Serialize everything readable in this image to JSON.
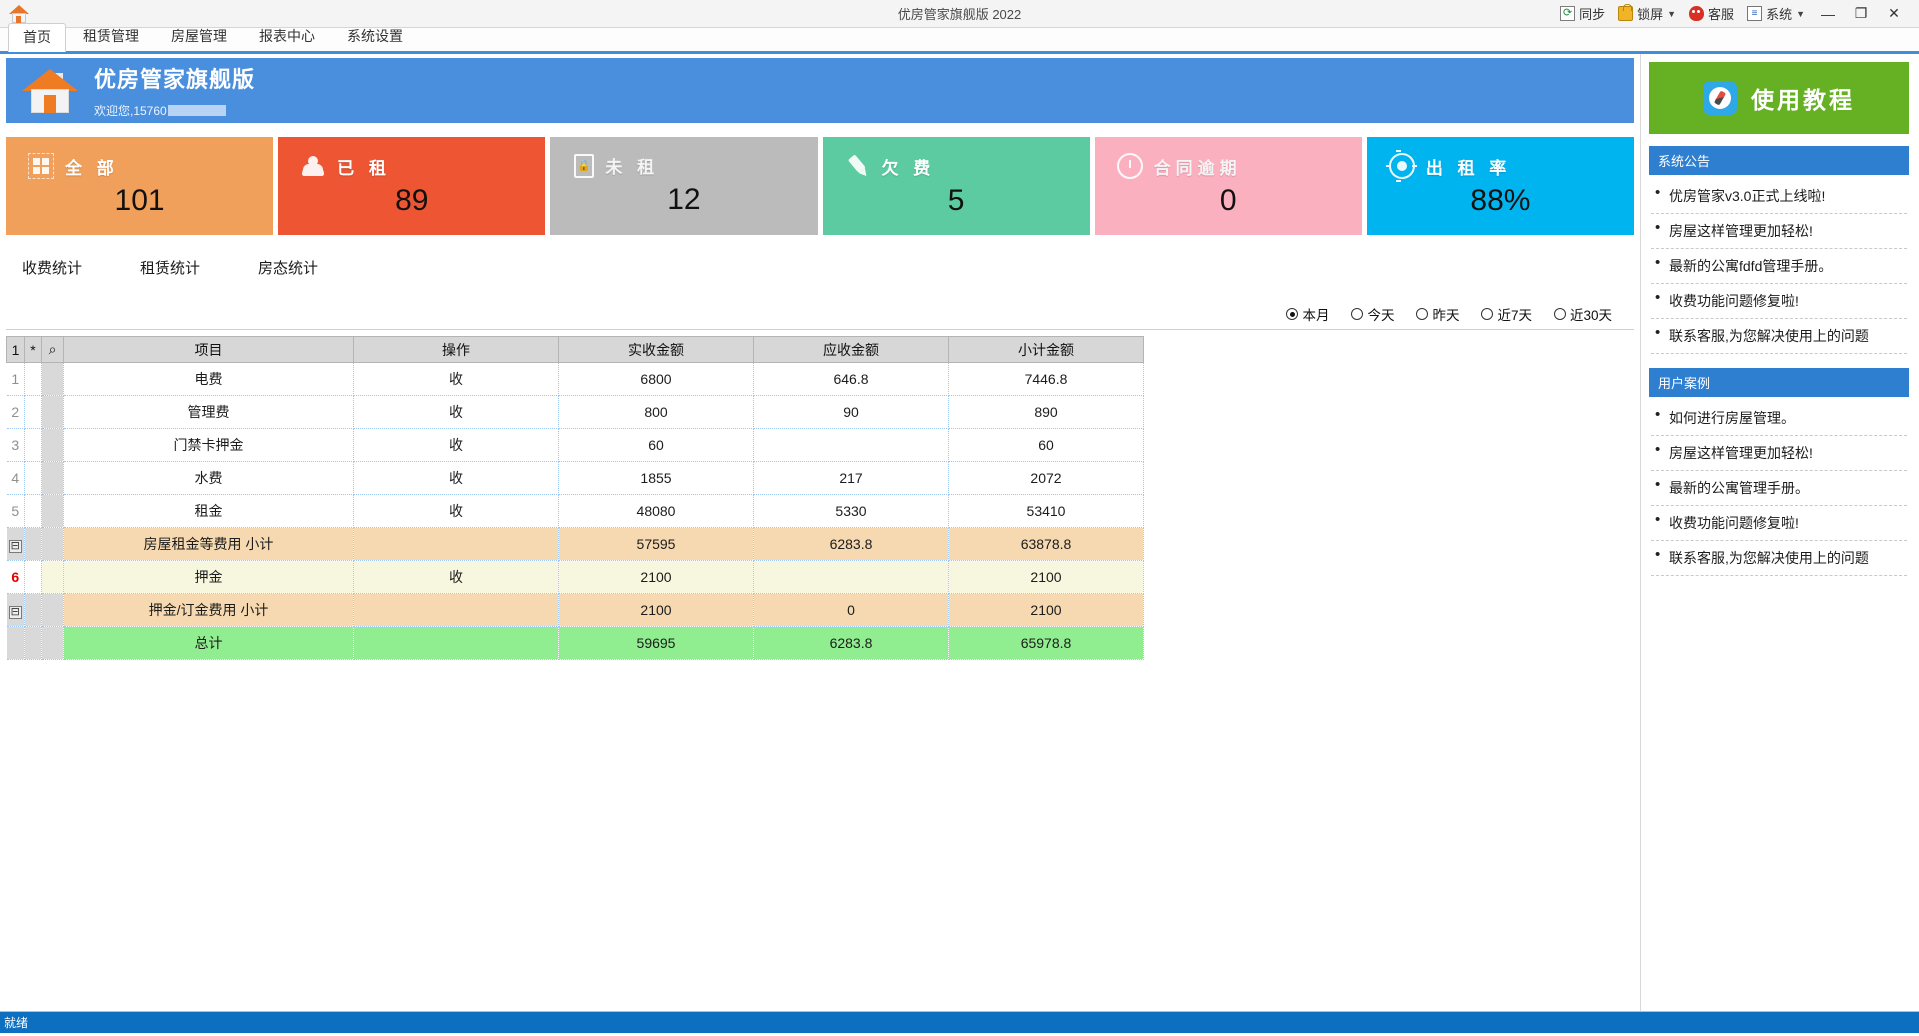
{
  "titlebar": {
    "title": "优房管家旗舰版 2022",
    "buttons": [
      {
        "label": "同步",
        "icon": "sync-icon",
        "caret": false
      },
      {
        "label": "锁屏",
        "icon": "lock-icon",
        "caret": true
      },
      {
        "label": "客服",
        "icon": "qq-icon",
        "caret": false
      },
      {
        "label": "系统",
        "icon": "system-icon",
        "caret": true
      }
    ],
    "minimize": "—",
    "maximize": "❐",
    "close": "✕"
  },
  "menu": {
    "tabs": [
      {
        "label": "首页",
        "active": true
      },
      {
        "label": "租赁管理",
        "active": false
      },
      {
        "label": "房屋管理",
        "active": false
      },
      {
        "label": "报表中心",
        "active": false
      },
      {
        "label": "系统设置",
        "active": false
      }
    ]
  },
  "banner": {
    "title": "优房管家旗舰版",
    "welcome_prefix": "欢迎您,15760"
  },
  "cards": [
    {
      "label": "全 部",
      "value": "101",
      "color": "#f0a05a",
      "icon": "grid-icon"
    },
    {
      "label": "已 租",
      "value": "89",
      "color": "#ee5533",
      "icon": "users-icon"
    },
    {
      "label": "未 租",
      "value": "12",
      "color": "#bbbbbb",
      "icon": "lock-door-icon"
    },
    {
      "label": "欠 费",
      "value": "5",
      "color": "#5ccba2",
      "icon": "pen-icon"
    },
    {
      "label": "合同逾期",
      "value": "0",
      "color": "#fbb0c0",
      "icon": "clock-icon"
    },
    {
      "label": "出 租 率",
      "value": "88%",
      "color": "#00b4f0",
      "icon": "target-icon"
    }
  ],
  "subtabs": [
    {
      "label": "收费统计",
      "active": true
    },
    {
      "label": "租赁统计",
      "active": false
    },
    {
      "label": "房态统计",
      "active": false
    }
  ],
  "period_filter": {
    "options": [
      {
        "label": "本月",
        "selected": true
      },
      {
        "label": "今天",
        "selected": false
      },
      {
        "label": "昨天",
        "selected": false
      },
      {
        "label": "近7天",
        "selected": false
      },
      {
        "label": "近30天",
        "selected": false
      }
    ]
  },
  "table": {
    "indicator_headers": [
      "1",
      "*",
      "⌕"
    ],
    "columns": [
      "项目",
      "操作",
      "实收金额",
      "应收金额",
      "小计金额"
    ],
    "rows": [
      {
        "ind": "1",
        "kind": "data",
        "item": "电费",
        "op": "收",
        "actual": "6800",
        "due": "646.8",
        "subtotal": "7446.8"
      },
      {
        "ind": "2",
        "kind": "data",
        "item": "管理费",
        "op": "收",
        "actual": "800",
        "due": "90",
        "subtotal": "890"
      },
      {
        "ind": "3",
        "kind": "data",
        "item": "门禁卡押金",
        "op": "收",
        "actual": "60",
        "due": "",
        "subtotal": "60"
      },
      {
        "ind": "4",
        "kind": "data",
        "item": "水费",
        "op": "收",
        "actual": "1855",
        "due": "217",
        "subtotal": "2072"
      },
      {
        "ind": "5",
        "kind": "data",
        "item": "租金",
        "op": "收",
        "actual": "48080",
        "due": "5330",
        "subtotal": "53410"
      },
      {
        "ind": "⊟",
        "kind": "sub",
        "item": "房屋租金等费用 小计",
        "op": "",
        "actual": "57595",
        "due": "6283.8",
        "subtotal": "63878.8"
      },
      {
        "ind": "6",
        "kind": "selected",
        "item": "押金",
        "op": "收",
        "actual": "2100",
        "due": "",
        "subtotal": "2100"
      },
      {
        "ind": "⊟",
        "kind": "sub",
        "item": "押金/订金费用 小计",
        "op": "",
        "actual": "2100",
        "due": "0",
        "subtotal": "2100"
      },
      {
        "ind": "",
        "kind": "total",
        "item": "总计",
        "op": "",
        "actual": "59695",
        "due": "6283.8",
        "subtotal": "65978.8"
      }
    ]
  },
  "sidebar": {
    "tutorial_label": "使用教程",
    "announcements": {
      "title": "系统公告",
      "items": [
        "优房管家v3.0正式上线啦!",
        "房屋这样管理更加轻松!",
        "最新的公寓fdfd管理手册。",
        "收费功能问题修复啦!",
        "联系客服,为您解决使用上的问题"
      ]
    },
    "cases": {
      "title": "用户案例",
      "items": [
        "如何进行房屋管理。",
        "房屋这样管理更加轻松!",
        "最新的公寓管理手册。",
        "收费功能问题修复啦!",
        "联系客服,为您解决使用上的问题"
      ]
    }
  },
  "statusbar": {
    "text": "就绪"
  }
}
